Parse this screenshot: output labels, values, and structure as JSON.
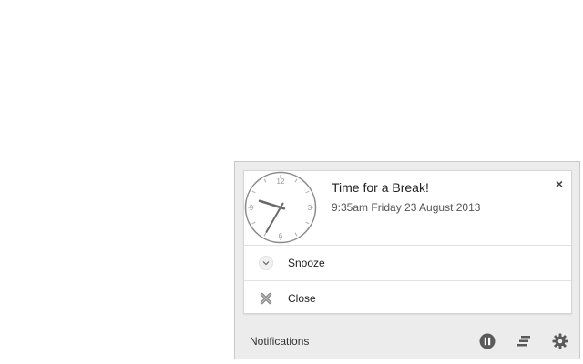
{
  "notification": {
    "title": "Time for a Break!",
    "message": "9:35am Friday 23 August 2013",
    "close_symbol": "×",
    "clock": {
      "hour": 9,
      "minute": 35,
      "numerals": {
        "n12": "12",
        "n3": "3",
        "n6": "6",
        "n9": "9"
      }
    },
    "actions": [
      {
        "label": "Snooze",
        "icon": "chevron-down-icon"
      },
      {
        "label": "Close",
        "icon": "close-x-icon"
      }
    ]
  },
  "footer": {
    "label": "Notifications",
    "icons": [
      "pause-icon",
      "clear-all-icon",
      "gear-icon"
    ]
  },
  "colors": {
    "panel_bg": "#ececec",
    "card_bg": "#ffffff",
    "icon_gray": "#5a5a5a"
  }
}
